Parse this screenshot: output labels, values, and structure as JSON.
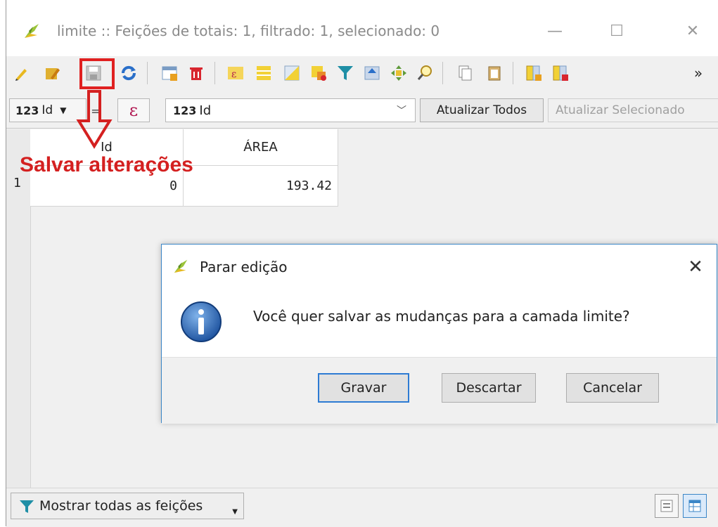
{
  "window": {
    "title": "limite :: Feições de totais: 1, filtrado: 1, selecionado: 0",
    "minimize": "—",
    "maximize": "☐",
    "close": "✕"
  },
  "toolbar": {
    "tools": [
      "toggle-edit-icon",
      "multi-edit-icon",
      "save-edits-icon",
      "reload-icon",
      "add-feature-icon",
      "delete-feature-icon",
      "select-expression-icon",
      "select-all-icon",
      "invert-selection-icon",
      "deselect-icon",
      "filter-selected-icon",
      "move-to-top-icon",
      "pan-to-selected-icon",
      "zoom-to-selected-icon",
      "copy-icon",
      "paste-icon",
      "new-field-icon",
      "delete-field-icon"
    ],
    "overflow": "»"
  },
  "calcbar": {
    "field_type": "123",
    "field_name": "Id",
    "equals": "=",
    "expression_symbol": "ε",
    "combo_type": "123",
    "combo_value": "Id",
    "update_all": "Atualizar Todos",
    "update_selected": "Atualizar Selecionado"
  },
  "table": {
    "columns": [
      "Id",
      "ÁREA"
    ],
    "rows": [
      {
        "num": "1",
        "id": "0",
        "area": "193.42"
      }
    ]
  },
  "annotation": {
    "text": "Salvar alterações",
    "color": "#d42020"
  },
  "dialog": {
    "title": "Parar edição",
    "message": "Você quer salvar as mudanças para a camada limite?",
    "close": "✕",
    "buttons": {
      "save": "Gravar",
      "discard": "Descartar",
      "cancel": "Cancelar"
    }
  },
  "statusbar": {
    "filter_label": "Mostrar todas as feições"
  }
}
